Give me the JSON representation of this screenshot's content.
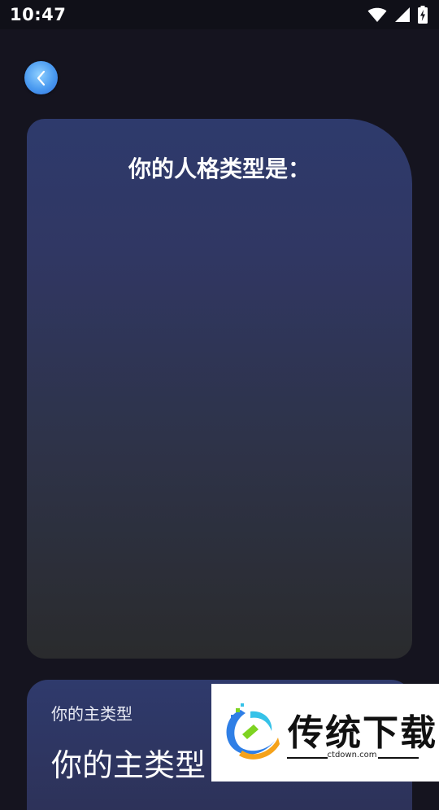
{
  "status_bar": {
    "time": "10:47",
    "icons": [
      "wifi-icon",
      "signal-icon",
      "battery-charging-icon"
    ]
  },
  "navigation": {
    "back_icon": "chevron-left-icon",
    "accent_color": "#4a9af0"
  },
  "result_card": {
    "title": "你的人格类型是："
  },
  "type_card": {
    "label": "你的主类型",
    "value": "你的主类型"
  },
  "watermark": {
    "name": "传统下载",
    "url": "ctdown.com"
  }
}
